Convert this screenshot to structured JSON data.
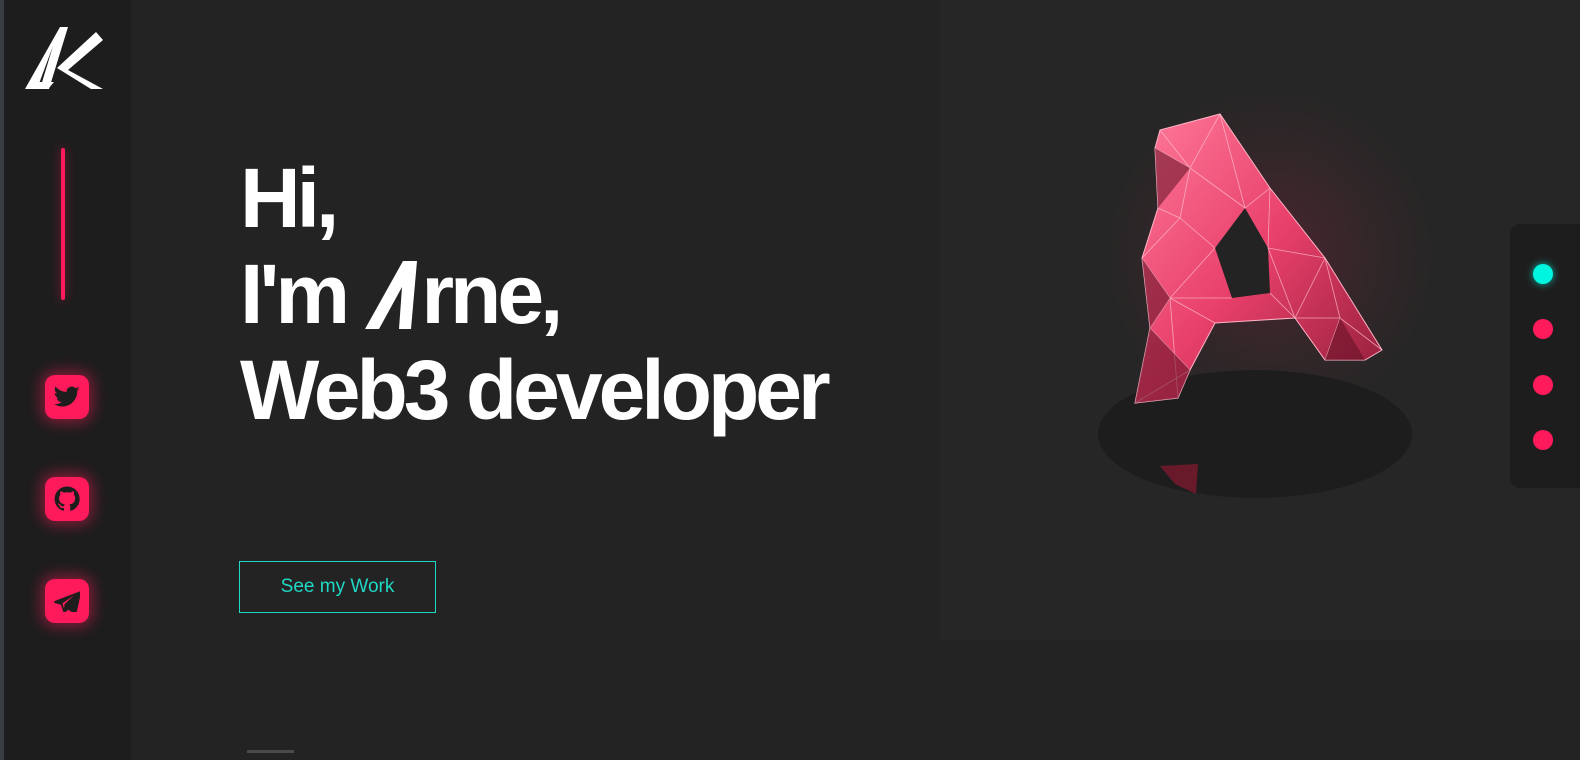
{
  "brand": {
    "logo_text": "AK"
  },
  "hero": {
    "line1": "Hi,",
    "line2_prefix": "I'm ",
    "name_letter": "A",
    "name_rest": "rne,",
    "line3": "Web3 developer"
  },
  "cta": {
    "label": "See my Work"
  },
  "social": [
    {
      "icon": "twitter-icon"
    },
    {
      "icon": "github-icon"
    },
    {
      "icon": "telegram-icon"
    }
  ],
  "section_nav": {
    "count": 4,
    "active_index": 0
  },
  "colors": {
    "background": "#242323",
    "sidebar": "#1d1d1d",
    "accent_pink": "#ff1a5b",
    "accent_teal": "#1fd8c5",
    "text": "#ffffff"
  }
}
